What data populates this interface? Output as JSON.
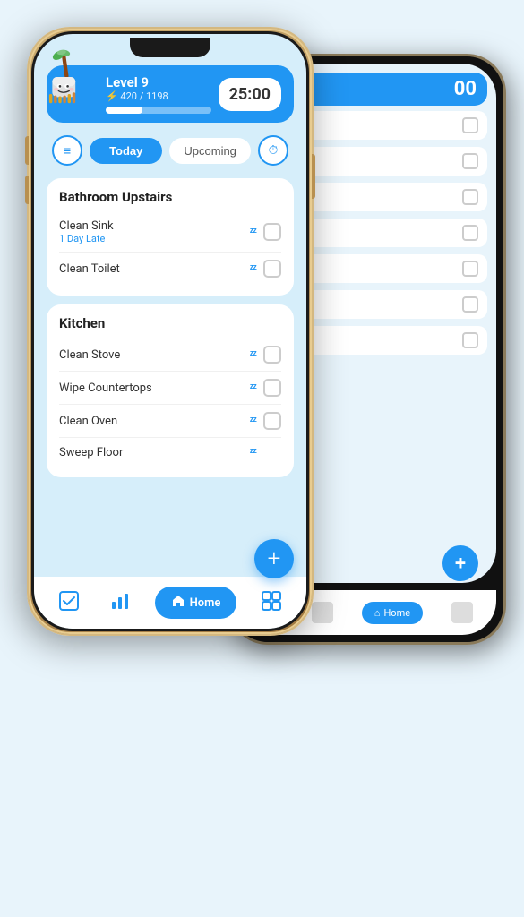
{
  "app": {
    "background_color": "#d6eefa"
  },
  "header": {
    "level_label": "Level 9",
    "xp_current": "420",
    "xp_total": "1198",
    "xp_display": "⚡ 420 / 1198",
    "timer": "25:00",
    "progress_percent": 35
  },
  "tabs": {
    "today_label": "Today",
    "upcoming_label": "Upcoming"
  },
  "sections": [
    {
      "title": "Bathroom Upstairs",
      "tasks": [
        {
          "name": "Clean Sink",
          "late_text": "1 Day Late",
          "is_late": true
        },
        {
          "name": "Clean Toilet",
          "late_text": "",
          "is_late": false
        }
      ]
    },
    {
      "title": "Kitchen",
      "tasks": [
        {
          "name": "Clean Stove",
          "late_text": "",
          "is_late": false
        },
        {
          "name": "Wipe Countertops",
          "late_text": "",
          "is_late": false
        },
        {
          "name": "Clean Oven",
          "late_text": "",
          "is_late": false
        },
        {
          "name": "Sweep Floor",
          "late_text": "",
          "is_late": false
        }
      ]
    }
  ],
  "nav": {
    "home_label": "Home"
  },
  "icons": {
    "filter": "≡",
    "clock": "⏱",
    "zzz": "ᶻᶻ",
    "plus": "+",
    "home": "⌂",
    "tasks": "☑",
    "stats": "📊",
    "rooms": "▣"
  },
  "back_phone": {
    "timer": "00"
  }
}
